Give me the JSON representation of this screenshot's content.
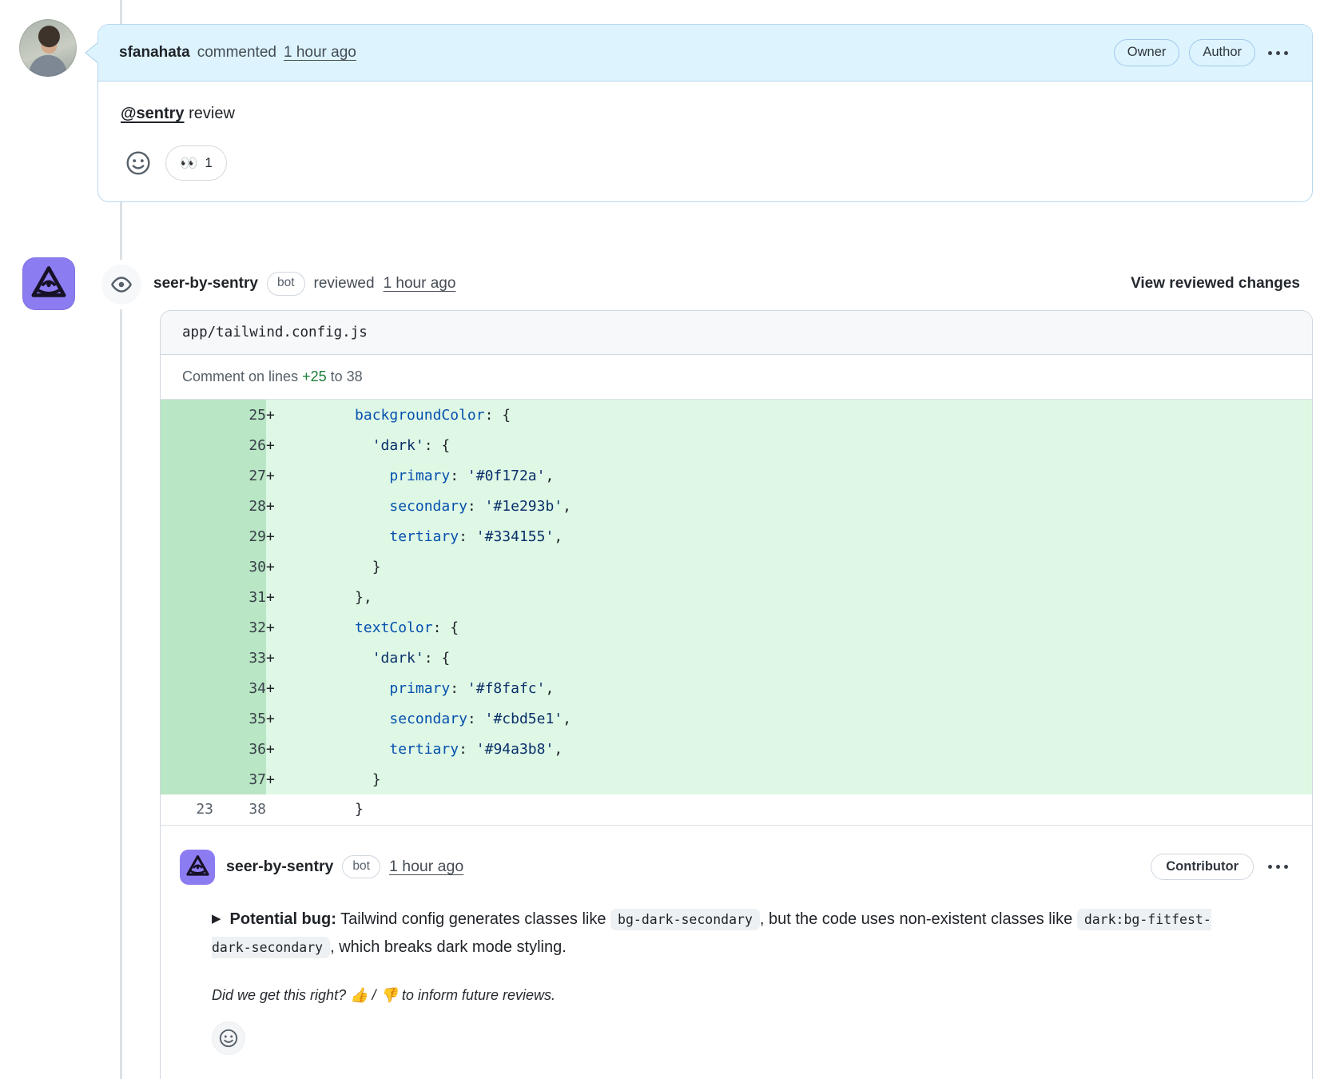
{
  "comment1": {
    "author": "sfanahata",
    "action": "commented",
    "time": "1 hour ago",
    "badges": [
      "Owner",
      "Author"
    ],
    "body": {
      "mention": "@sentry",
      "rest": " review"
    },
    "reactions": [
      {
        "emoji": "👀",
        "count": "1"
      }
    ]
  },
  "review": {
    "author": "seer-by-sentry",
    "bot_label": "bot",
    "action": "reviewed",
    "time": "1 hour ago",
    "view_link": "View reviewed changes"
  },
  "file": {
    "path": "app/tailwind.config.js",
    "range_prefix": "Comment on lines ",
    "range_added": "+25",
    "range_suffix": " to 38"
  },
  "diff": {
    "rows": [
      {
        "old": "",
        "new": "25",
        "sign": "+",
        "type": "add",
        "seg": [
          [
            "p",
            "      "
          ],
          [
            "k",
            "backgroundColor"
          ],
          [
            "p",
            ": {"
          ]
        ]
      },
      {
        "old": "",
        "new": "26",
        "sign": "+",
        "type": "add",
        "seg": [
          [
            "p",
            "        "
          ],
          [
            "s",
            "'dark'"
          ],
          [
            "p",
            ": {"
          ]
        ]
      },
      {
        "old": "",
        "new": "27",
        "sign": "+",
        "type": "add",
        "seg": [
          [
            "p",
            "          "
          ],
          [
            "k",
            "primary"
          ],
          [
            "p",
            ": "
          ],
          [
            "s",
            "'#0f172a'"
          ],
          [
            "p",
            ","
          ]
        ]
      },
      {
        "old": "",
        "new": "28",
        "sign": "+",
        "type": "add",
        "seg": [
          [
            "p",
            "          "
          ],
          [
            "k",
            "secondary"
          ],
          [
            "p",
            ": "
          ],
          [
            "s",
            "'#1e293b'"
          ],
          [
            "p",
            ","
          ]
        ]
      },
      {
        "old": "",
        "new": "29",
        "sign": "+",
        "type": "add",
        "seg": [
          [
            "p",
            "          "
          ],
          [
            "k",
            "tertiary"
          ],
          [
            "p",
            ": "
          ],
          [
            "s",
            "'#334155'"
          ],
          [
            "p",
            ","
          ]
        ]
      },
      {
        "old": "",
        "new": "30",
        "sign": "+",
        "type": "add",
        "seg": [
          [
            "p",
            "        }"
          ]
        ]
      },
      {
        "old": "",
        "new": "31",
        "sign": "+",
        "type": "add",
        "seg": [
          [
            "p",
            "      },"
          ]
        ]
      },
      {
        "old": "",
        "new": "32",
        "sign": "+",
        "type": "add",
        "seg": [
          [
            "p",
            "      "
          ],
          [
            "k",
            "textColor"
          ],
          [
            "p",
            ": {"
          ]
        ]
      },
      {
        "old": "",
        "new": "33",
        "sign": "+",
        "type": "add",
        "seg": [
          [
            "p",
            "        "
          ],
          [
            "s",
            "'dark'"
          ],
          [
            "p",
            ": {"
          ]
        ]
      },
      {
        "old": "",
        "new": "34",
        "sign": "+",
        "type": "add",
        "seg": [
          [
            "p",
            "          "
          ],
          [
            "k",
            "primary"
          ],
          [
            "p",
            ": "
          ],
          [
            "s",
            "'#f8fafc'"
          ],
          [
            "p",
            ","
          ]
        ]
      },
      {
        "old": "",
        "new": "35",
        "sign": "+",
        "type": "add",
        "seg": [
          [
            "p",
            "          "
          ],
          [
            "k",
            "secondary"
          ],
          [
            "p",
            ": "
          ],
          [
            "s",
            "'#cbd5e1'"
          ],
          [
            "p",
            ","
          ]
        ]
      },
      {
        "old": "",
        "new": "36",
        "sign": "+",
        "type": "add",
        "seg": [
          [
            "p",
            "          "
          ],
          [
            "k",
            "tertiary"
          ],
          [
            "p",
            ": "
          ],
          [
            "s",
            "'#94a3b8'"
          ],
          [
            "p",
            ","
          ]
        ]
      },
      {
        "old": "",
        "new": "37",
        "sign": "+",
        "type": "add",
        "seg": [
          [
            "p",
            "        }"
          ]
        ]
      },
      {
        "old": "23",
        "new": "38",
        "sign": "",
        "type": "context",
        "seg": [
          [
            "p",
            "      }"
          ]
        ]
      }
    ]
  },
  "comment2": {
    "author": "seer-by-sentry",
    "bot_label": "bot",
    "time": "1 hour ago",
    "badge": "Contributor",
    "marker": "▶",
    "body": [
      [
        "b",
        "Potential bug:"
      ],
      [
        "t",
        " Tailwind config generates classes like "
      ],
      [
        "code",
        "bg-dark-secondary"
      ],
      [
        "t",
        ", but the code uses non-existent classes like "
      ],
      [
        "code",
        "dark:bg-fitfest-dark-secondary"
      ],
      [
        "t",
        ", which breaks dark mode styling."
      ]
    ],
    "note": "Did we get this right? 👍 / 👎 to inform future reviews."
  }
}
